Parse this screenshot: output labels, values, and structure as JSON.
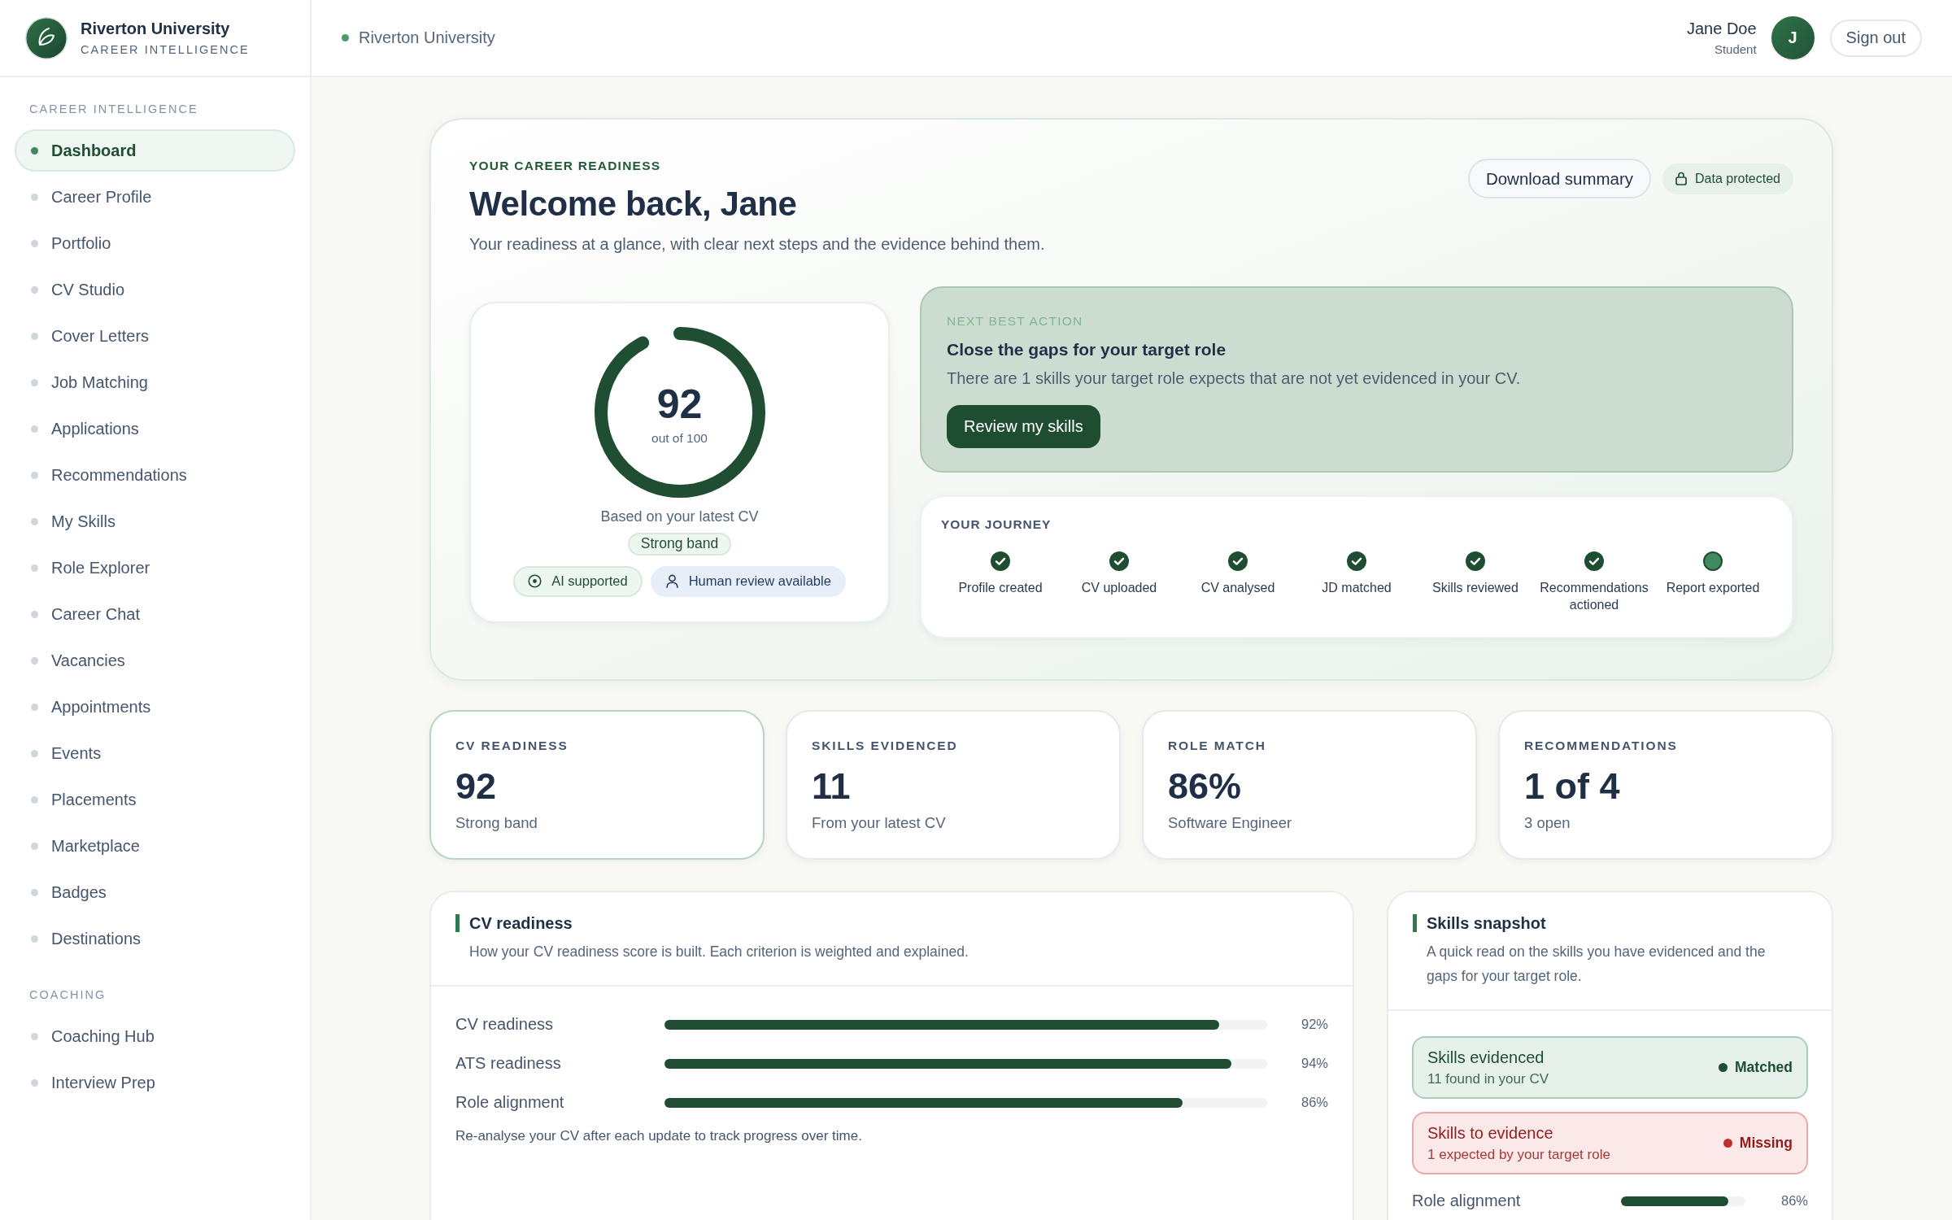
{
  "brand": {
    "name": "Riverton University",
    "tagline": "CAREER INTELLIGENCE"
  },
  "topbar": {
    "institution": "Riverton University",
    "user_name": "Jane Doe",
    "user_role": "Student",
    "avatar_initial": "J",
    "sign_out": "Sign out"
  },
  "sidebar": {
    "sections": [
      {
        "label": "CAREER INTELLIGENCE",
        "items": [
          {
            "label": "Dashboard",
            "selected": true
          },
          {
            "label": "Career Profile",
            "selected": false
          },
          {
            "label": "Portfolio",
            "selected": false
          },
          {
            "label": "CV Studio",
            "selected": false
          },
          {
            "label": "Cover Letters",
            "selected": false
          },
          {
            "label": "Job Matching",
            "selected": false
          },
          {
            "label": "Applications",
            "selected": false
          },
          {
            "label": "Recommendations",
            "selected": false
          },
          {
            "label": "My Skills",
            "selected": false
          },
          {
            "label": "Role Explorer",
            "selected": false
          },
          {
            "label": "Career Chat",
            "selected": false
          },
          {
            "label": "Vacancies",
            "selected": false
          },
          {
            "label": "Appointments",
            "selected": false
          },
          {
            "label": "Events",
            "selected": false
          },
          {
            "label": "Placements",
            "selected": false
          },
          {
            "label": "Marketplace",
            "selected": false
          },
          {
            "label": "Badges",
            "selected": false
          },
          {
            "label": "Destinations",
            "selected": false
          }
        ]
      },
      {
        "label": "COACHING",
        "items": [
          {
            "label": "Coaching Hub",
            "selected": false
          },
          {
            "label": "Interview Prep",
            "selected": false
          }
        ]
      }
    ]
  },
  "hero": {
    "eyebrow": "YOUR CAREER READINESS",
    "title": "Welcome back, Jane",
    "subtitle": "Your readiness at a glance, with clear next steps and the evidence behind them.",
    "download_button": "Download summary",
    "privacy_badge": "Data protected",
    "score": {
      "value": "92",
      "caption": "out of 100",
      "level": 0.92,
      "basis": "Based on your latest CV",
      "band": "Strong band",
      "chips": [
        {
          "kind": "ai",
          "label": "AI supported"
        },
        {
          "kind": "human",
          "label": "Human review available"
        }
      ]
    },
    "next_action": {
      "eyebrow": "NEXT BEST ACTION",
      "title": "Close the gaps for your target role",
      "body": "There are 1 skills your target role expects that are not yet evidenced in your CV.",
      "button": "Review my skills"
    },
    "journey": {
      "title": "YOUR JOURNEY",
      "steps": [
        {
          "label": "Profile created",
          "done": true
        },
        {
          "label": "CV uploaded",
          "done": true
        },
        {
          "label": "CV analysed",
          "done": true
        },
        {
          "label": "JD matched",
          "done": true
        },
        {
          "label": "Skills reviewed",
          "done": true
        },
        {
          "label": "Recommendations actioned",
          "done": true
        },
        {
          "label": "Report exported",
          "done": false
        }
      ]
    }
  },
  "stats": [
    {
      "label": "CV READINESS",
      "value": "92",
      "note": "Strong band",
      "selected": true
    },
    {
      "label": "SKILLS EVIDENCED",
      "value": "11",
      "note": "From your latest CV",
      "selected": false
    },
    {
      "label": "ROLE MATCH",
      "value": "86%",
      "note": "Software Engineer",
      "selected": false
    },
    {
      "label": "RECOMMENDATIONS",
      "value": "1 of 4",
      "note": "3 open",
      "selected": false
    }
  ],
  "cv_readiness": {
    "title": "CV readiness",
    "subtitle": "How your CV readiness score is built. Each criterion is weighted and explained.",
    "rows": [
      {
        "label": "CV readiness",
        "level": 0.92,
        "reading": "92%"
      },
      {
        "label": "ATS readiness",
        "level": 0.94,
        "reading": "94%"
      },
      {
        "label": "Role alignment",
        "level": 0.86,
        "reading": "86%"
      }
    ],
    "footnote": "Re-analyse your CV after each update to track progress over time."
  },
  "skills_snapshot": {
    "title": "Skills snapshot",
    "description": "A quick read on the skills you have evidenced and the gaps for your target role.",
    "groups": [
      {
        "kind": "matched",
        "title": "Skills evidenced",
        "detail": "11 found in your CV",
        "status": "Matched"
      },
      {
        "kind": "missing",
        "title": "Skills to evidence",
        "detail": "1 expected by your target role",
        "status": "Missing"
      }
    ],
    "alignment": {
      "label": "Role alignment",
      "level": 0.86,
      "reading": "86%"
    }
  }
}
